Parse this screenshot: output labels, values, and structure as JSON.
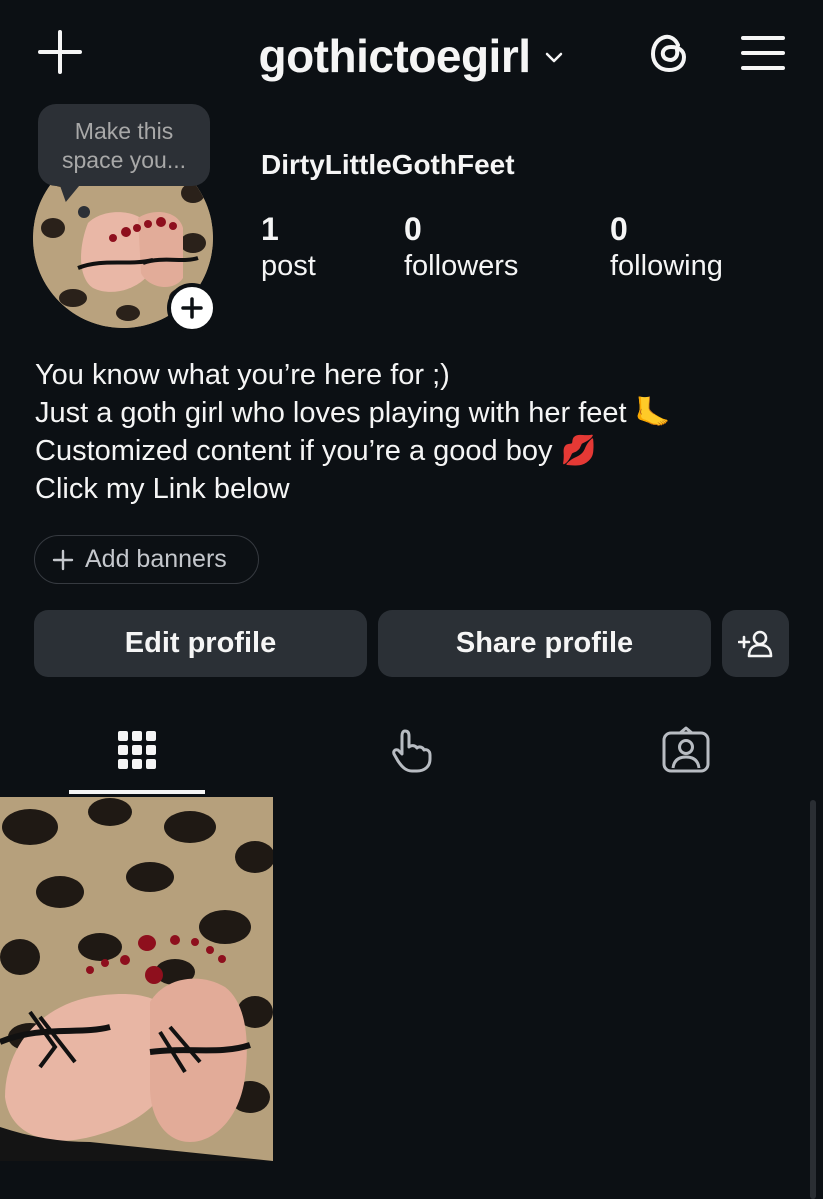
{
  "header": {
    "username": "gothictoegirl",
    "icons": {
      "create": "plus-icon",
      "account_switch": "chevron-down-icon",
      "threads": "threads-icon",
      "menu": "hamburger-menu-icon"
    }
  },
  "tooltip": {
    "text_line1": "Make this",
    "text_line2": "space you..."
  },
  "profile": {
    "display_name": "DirtyLittleGothFeet",
    "stats": [
      {
        "value": "1",
        "label": "post"
      },
      {
        "value": "0",
        "label": "followers"
      },
      {
        "value": "0",
        "label": "following"
      }
    ],
    "bio": [
      "You know what you’re here for ;)",
      "Just a goth girl who loves playing with her feet 🦶",
      "Customized content if you’re a good boy 💋",
      "Click my Link below"
    ]
  },
  "banners": {
    "label": "Add banners"
  },
  "actions": {
    "edit_label": "Edit profile",
    "share_label": "Share profile",
    "discover_icon": "add-person-icon"
  },
  "tabs": [
    {
      "name": "posts",
      "icon": "grid-icon",
      "active": true
    },
    {
      "name": "reels",
      "icon": "tap-gesture-icon",
      "active": false
    },
    {
      "name": "tagged",
      "icon": "tagged-person-icon",
      "active": false
    }
  ],
  "posts": [
    {
      "type": "photo",
      "subject": "feet with red toenails on leopard print"
    }
  ],
  "colors": {
    "background": "#0c1014",
    "button": "#2b3036",
    "text": "#f5f5f5",
    "muted": "#a8a8a8",
    "nail_red": "#8e0f1d"
  }
}
